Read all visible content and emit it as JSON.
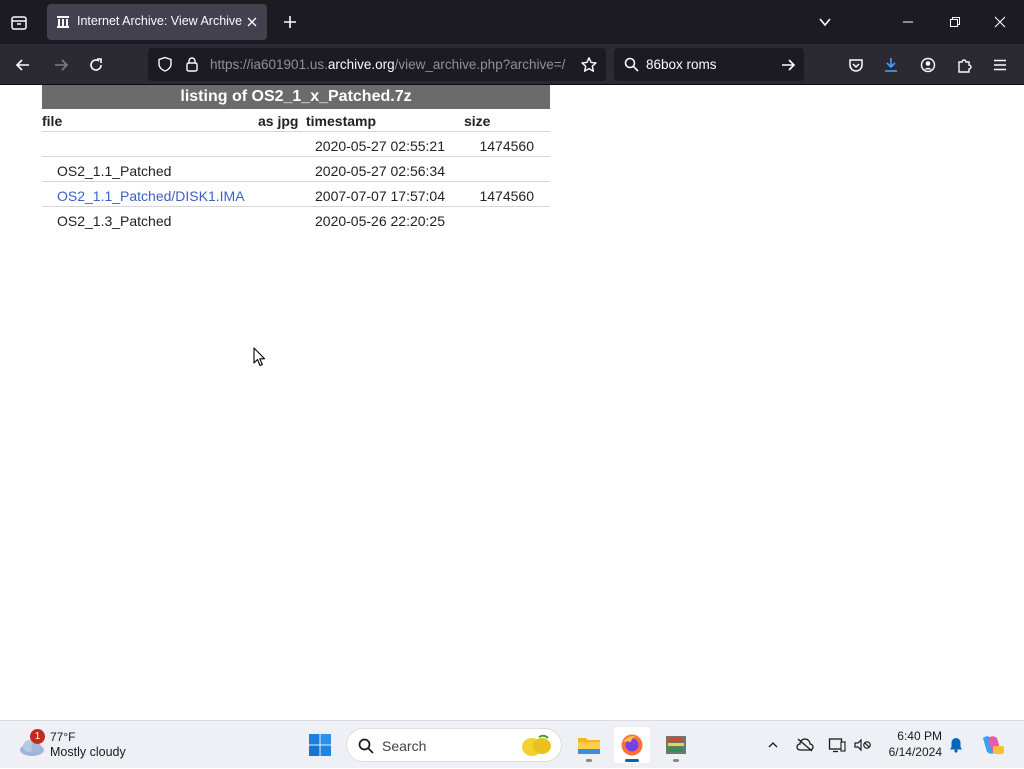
{
  "browser": {
    "tab_title": "Internet Archive: View Archive",
    "url_prefix": "https://ia601901.us.",
    "url_domain": "archive.org",
    "url_suffix": "/view_archive.php?archive=/",
    "search_query": "86box roms"
  },
  "listing": {
    "caption": "listing of OS2_1_x_Patched.7z",
    "headers": {
      "file": "file",
      "as_jpg": "as jpg",
      "timestamp": "timestamp",
      "size": "size"
    },
    "rows": [
      {
        "file": "",
        "timestamp": "2020-05-27 02:55:21",
        "size": "1474560"
      },
      {
        "file": "OS2_1.1_Patched",
        "timestamp": "2020-05-27 02:56:34",
        "size": ""
      },
      {
        "file": "OS2_1.1_Patched/DISK1.IMA",
        "timestamp": "2007-07-07 17:57:04",
        "size": "1474560"
      },
      {
        "file": "OS2_1.3_Patched",
        "timestamp": "2020-05-26 22:20:25",
        "size": ""
      }
    ]
  },
  "taskbar": {
    "weather_badge": "1",
    "weather_temp": "77°F",
    "weather_condition": "Mostly cloudy",
    "search_label": "Search",
    "clock_time": "6:40 PM",
    "clock_date": "6/14/2024"
  },
  "colors": {
    "link": "#3c5fc8",
    "caption_bg": "#6b6b6b",
    "chrome_dark": "#1c1b22",
    "accent": "#0067c0"
  }
}
